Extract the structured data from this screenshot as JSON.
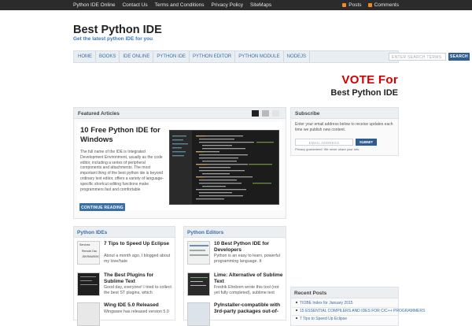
{
  "topbar": {
    "links": [
      "Python IDE Online",
      "Contact Us",
      "Terms and Conditions",
      "Privacy Policy",
      "SiteMaps"
    ],
    "feeds": [
      "Posts",
      "Comments"
    ],
    "feed_icon": "rss-icon",
    "feed_color": "#f08a24"
  },
  "header": {
    "title": "Best Python IDE",
    "tagline": "Get the latest python IDE for you"
  },
  "nav": {
    "items": [
      "HOME",
      "BOOKS",
      "IDE ONLINE",
      "PYTHON IDE",
      "PYTHON EDITOR",
      "PYTHON MODULE",
      "NODEJS"
    ],
    "search_placeholder": "ENTER SEARCH TERMS",
    "search_button": "SEARCH"
  },
  "banner": {
    "line1": "VOTE For",
    "line2": "Best Python IDE",
    "accent": "#d40000"
  },
  "featured": {
    "heading": "Featured Articles",
    "title": "10 Free Python IDE for Windows",
    "excerpt": "The full name of the IDE is Integrated Development Environment, usually as the code editor, including a series of peripheral components and attachments. The most important thing of the best python ide is beyond ordinary text editor, offers a variety of language-specific shortcut editing functions make programmers  fast and comfortable",
    "button": "CONTINUE READING"
  },
  "subscribe": {
    "heading": "Subscribe",
    "text": "Enter your email address below to receive updates each time we publish new content.",
    "placeholder": "EMAIL ADDRESS",
    "button": "SUBMIT",
    "note": "Privacy guaranteed. We never share your info."
  },
  "python_ides": {
    "heading": "Python IDEs",
    "entries": [
      {
        "title": "7 Tips to Speed Up Eclipse",
        "excerpt": "About a month ago, I blogged about my love/hate"
      },
      {
        "title": "The Best Plugins for Sublime Text",
        "excerpt": "Good day, everyone! I tried to collect the best ST plugins, which"
      },
      {
        "title": "Wing IDE 5.0 Released",
        "excerpt": "Wingware has released version 5.0"
      }
    ],
    "thumb_labels": [
      "Services",
      "Remote Dsc",
      "JDKRAWDSK"
    ]
  },
  "python_editors": {
    "heading": "Python Editors",
    "entries": [
      {
        "title": "10 Best Python IDE for Developers",
        "excerpt": "Python is an easy to learn, powerful programming language. It"
      },
      {
        "title": "Lime: Alternative of Sublime Text",
        "excerpt": "Fredrik Ehnbom wrote this tool (not yet fully completed), sublime text"
      },
      {
        "title": "PyInstaller-compatible with 3rd-party packages out-of-",
        "excerpt": ""
      }
    ]
  },
  "recent": {
    "heading": "Recent Posts",
    "items": [
      "TIOBE Index for January 2015",
      "15 ESSENTIAL COMPILERS AND IDES FOR C/C++ PROGRAMMERS",
      "7 Tips to Speed Up Eclipse"
    ]
  },
  "colors": {
    "link": "#3b6ea5",
    "button": "#2f5d8f",
    "topbar": "#2b2b2b"
  }
}
